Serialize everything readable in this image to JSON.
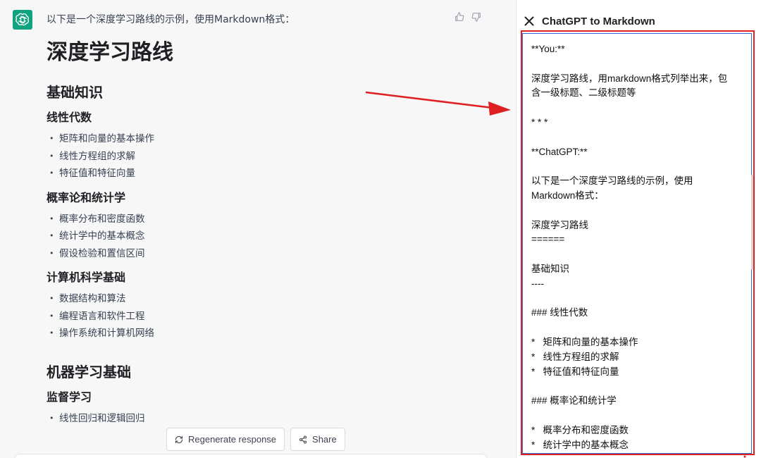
{
  "chat": {
    "intro": "以下是一个深度学习路线的示例，使用Markdown格式：",
    "title": "深度学习路线",
    "sections": [
      {
        "heading": "基础知识",
        "subsections": [
          {
            "heading": "线性代数",
            "items": [
              "矩阵和向量的基本操作",
              "线性方程组的求解",
              "特征值和特征向量"
            ]
          },
          {
            "heading": "概率论和统计学",
            "items": [
              "概率分布和密度函数",
              "统计学中的基本概念",
              "假设检验和置信区间"
            ]
          },
          {
            "heading": "计算机科学基础",
            "items": [
              "数据结构和算法",
              "编程语言和软件工程",
              "操作系统和计算机网络"
            ]
          }
        ]
      },
      {
        "heading": "机器学习基础",
        "subsections": [
          {
            "heading": "监督学习",
            "items": [
              "线性回归和逻辑回归"
            ]
          }
        ]
      }
    ],
    "regenerate_label": "Regenerate response",
    "share_label": "Share"
  },
  "panel": {
    "title": "ChatGPT to Markdown",
    "lines": [
      "**You:**",
      "",
      "深度学习路线，用markdown格式列举出来，包",
      "含一级标题、二级标题等",
      "",
      "* * *",
      "",
      "**ChatGPT:**",
      "",
      "以下是一个深度学习路线的示例，使用",
      "Markdown格式：",
      "",
      "深度学习路线",
      "======",
      "",
      "基础知识",
      "----",
      "",
      "### 线性代数",
      "",
      "*   矩阵和向量的基本操作",
      "*   线性方程组的求解",
      "*   特征值和特征向量",
      "",
      "### 概率论和统计学",
      "",
      "*   概率分布和密度函数",
      "*   统计学中的基本概念"
    ]
  },
  "icons": {
    "avatar": "openai-logo-icon",
    "thumbs_up": "thumbs-up-icon",
    "thumbs_down": "thumbs-down-icon",
    "regenerate": "refresh-icon",
    "share": "share-icon",
    "close": "close-icon"
  },
  "colors": {
    "brand": "#10a37f",
    "annotation_red": "#e02020",
    "annotation_blue": "#2f6bd8"
  }
}
